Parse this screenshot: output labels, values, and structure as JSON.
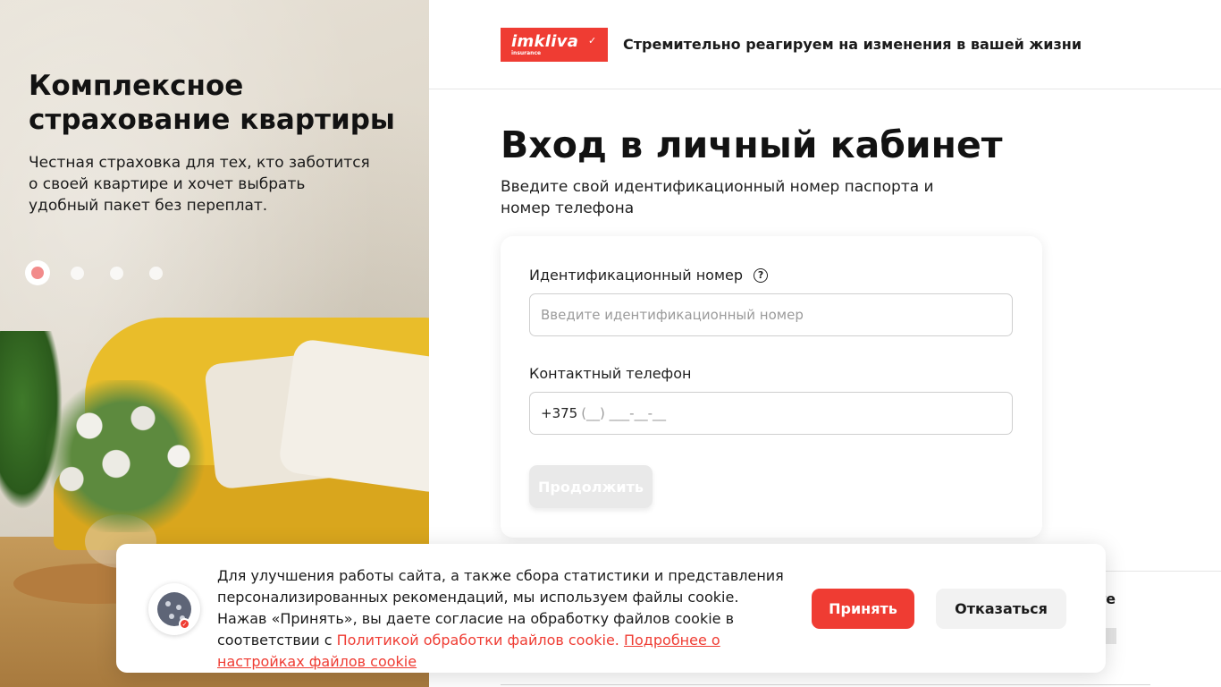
{
  "hero": {
    "title": "Комплексное страхование квартиры",
    "description": "Честная страховка для тех, кто заботится о своей квартире и хочет выбрать удобный пакет без переплат.",
    "slides_total": 4,
    "slide_active": 1
  },
  "header": {
    "logo_text": "imkliva",
    "logo_sub": "insurance",
    "tagline": "Стремительно реагируем на изменения в вашей жизни",
    "brand_color": "#ef3c33"
  },
  "login": {
    "title": "Вход в личный кабинет",
    "subtitle": "Введите свой идентификационный номер паспорта и номер телефона",
    "id_label": "Идентификационный номер",
    "id_help_icon": "question-circle-icon",
    "id_placeholder": "Введите идентификационный номер",
    "phone_label": "Контактный телефон",
    "phone_prefix": "+375",
    "phone_mask": "(__) ___-__-__",
    "continue_label": "Продолжить"
  },
  "behind": {
    "partial_text": "те"
  },
  "cookie": {
    "icon": "cookie-icon",
    "text": "Для улучшения работы сайта, а также сбора статистики и представления персонализированных рекомендаций, мы используем файлы cookie. Нажав «Принять», вы даете согласие на обработку файлов cookie в соответствии с",
    "policy_link": "Политикой обработки файлов cookie.",
    "settings_link": "Подробнее о настройках файлов cookie",
    "accept_label": "Принять",
    "decline_label": "Отказаться"
  }
}
